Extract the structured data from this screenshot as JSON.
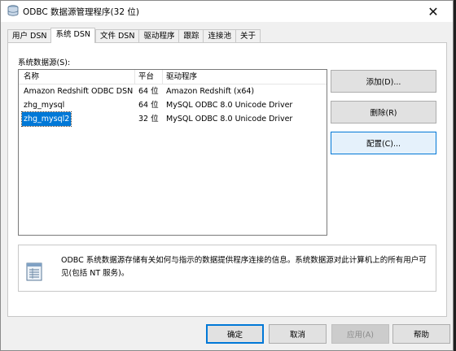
{
  "window": {
    "title": "ODBC 数据源管理程序(32 位)",
    "close_glyph": "✕"
  },
  "tabs": [
    {
      "label": "用户 DSN"
    },
    {
      "label": "系统 DSN"
    },
    {
      "label": "文件 DSN"
    },
    {
      "label": "驱动程序"
    },
    {
      "label": "跟踪"
    },
    {
      "label": "连接池"
    },
    {
      "label": "关于"
    }
  ],
  "active_tab": "系统 DSN",
  "system_dsn": {
    "label": "系统数据源(S):",
    "columns": {
      "name": "名称",
      "platform": "平台",
      "driver": "驱动程序"
    },
    "rows": [
      {
        "name": "Amazon Redshift ODBC DSN",
        "platform": "64 位",
        "driver": "Amazon Redshift (x64)"
      },
      {
        "name": "zhg_mysql",
        "platform": "64 位",
        "driver": "MySQL ODBC 8.0 Unicode Driver"
      },
      {
        "name": "zhg_mysql2",
        "platform": "32 位",
        "driver": "MySQL ODBC 8.0 Unicode Driver"
      }
    ],
    "selected_row": "zhg_mysql2"
  },
  "side_buttons": {
    "add": "添加(D)...",
    "remove": "删除(R)",
    "configure": "配置(C)..."
  },
  "info": {
    "text": "ODBC 系统数据源存储有关如何与指示的数据提供程序连接的信息。系统数据源对此计算机上的所有用户可见(包括 NT 服务)。",
    "icon": "data-sources-icon"
  },
  "bottom_buttons": {
    "ok": "确定",
    "cancel": "取消",
    "apply": "应用(A)",
    "help": "帮助"
  },
  "colors": {
    "accent": "#0078d7",
    "selection": "#0078d7"
  }
}
